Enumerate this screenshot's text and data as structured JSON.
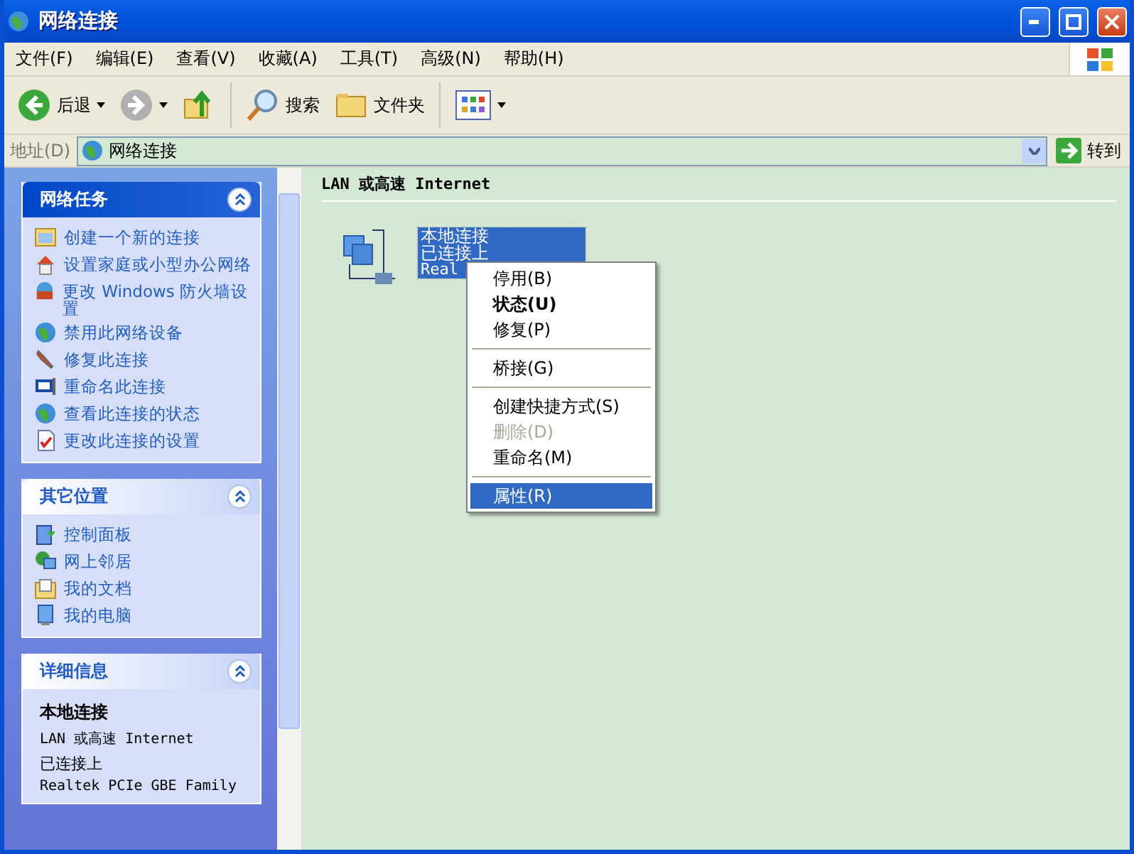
{
  "window": {
    "title": "网络连接"
  },
  "menu_bar": [
    "文件(F)",
    "编辑(E)",
    "查看(V)",
    "收藏(A)",
    "工具(T)",
    "高级(N)",
    "帮助(H)"
  ],
  "toolbar": [
    {
      "kind": "back",
      "label": "后退"
    },
    {
      "kind": "forward",
      "disabled": true
    },
    {
      "kind": "up"
    },
    {
      "kind": "search",
      "label": "搜索"
    },
    {
      "kind": "folders",
      "label": "文件夹"
    },
    {
      "kind": "views"
    }
  ],
  "address_bar": {
    "label": "地址(D)",
    "value": "网络连接",
    "go": "转到"
  },
  "task_panels": [
    {
      "kind": "special",
      "title": "网络任务",
      "expanded": true,
      "items": [
        "创建一个新的连接",
        "设置家庭或小型办公网络",
        "更改 Windows 防火墙设置",
        "禁用此网络设备",
        "修复此连接",
        "重命名此连接",
        "查看此连接的状态",
        "更改此连接的设置"
      ]
    },
    {
      "kind": "normal",
      "title": "其它位置",
      "expanded": true,
      "items": [
        "控制面板",
        "网上邻居",
        "我的文档",
        "我的电脑"
      ]
    },
    {
      "kind": "details",
      "title": "详细信息",
      "expanded": true,
      "details": {
        "name": "本地连接",
        "type": "LAN 或高速 Internet",
        "status": "已连接上",
        "device": "Realtek PCIe GBE Family"
      }
    }
  ],
  "content": {
    "group_title": "LAN 或高速 Internet",
    "connection": {
      "lines": [
        "本地连接",
        "已连接上",
        "Real"
      ],
      "selected": true
    }
  },
  "context_menu": [
    {
      "kind": "item",
      "label": "停用(B)",
      "default": false,
      "disabled": false,
      "selected": false
    },
    {
      "kind": "item",
      "label": "状态(U)",
      "default": true,
      "disabled": false,
      "selected": false
    },
    {
      "kind": "item",
      "label": "修复(P)",
      "default": false,
      "disabled": false,
      "selected": false
    },
    {
      "kind": "separator"
    },
    {
      "kind": "item",
      "label": "桥接(G)",
      "default": false,
      "disabled": false,
      "selected": false
    },
    {
      "kind": "separator"
    },
    {
      "kind": "item",
      "label": "创建快捷方式(S)",
      "default": false,
      "disabled": false,
      "selected": false
    },
    {
      "kind": "item",
      "label": "删除(D)",
      "default": false,
      "disabled": true,
      "selected": false
    },
    {
      "kind": "item",
      "label": "重命名(M)",
      "default": false,
      "disabled": false,
      "selected": false
    },
    {
      "kind": "separator"
    },
    {
      "kind": "item",
      "label": "属性(R)",
      "default": false,
      "disabled": false,
      "selected": true
    }
  ]
}
